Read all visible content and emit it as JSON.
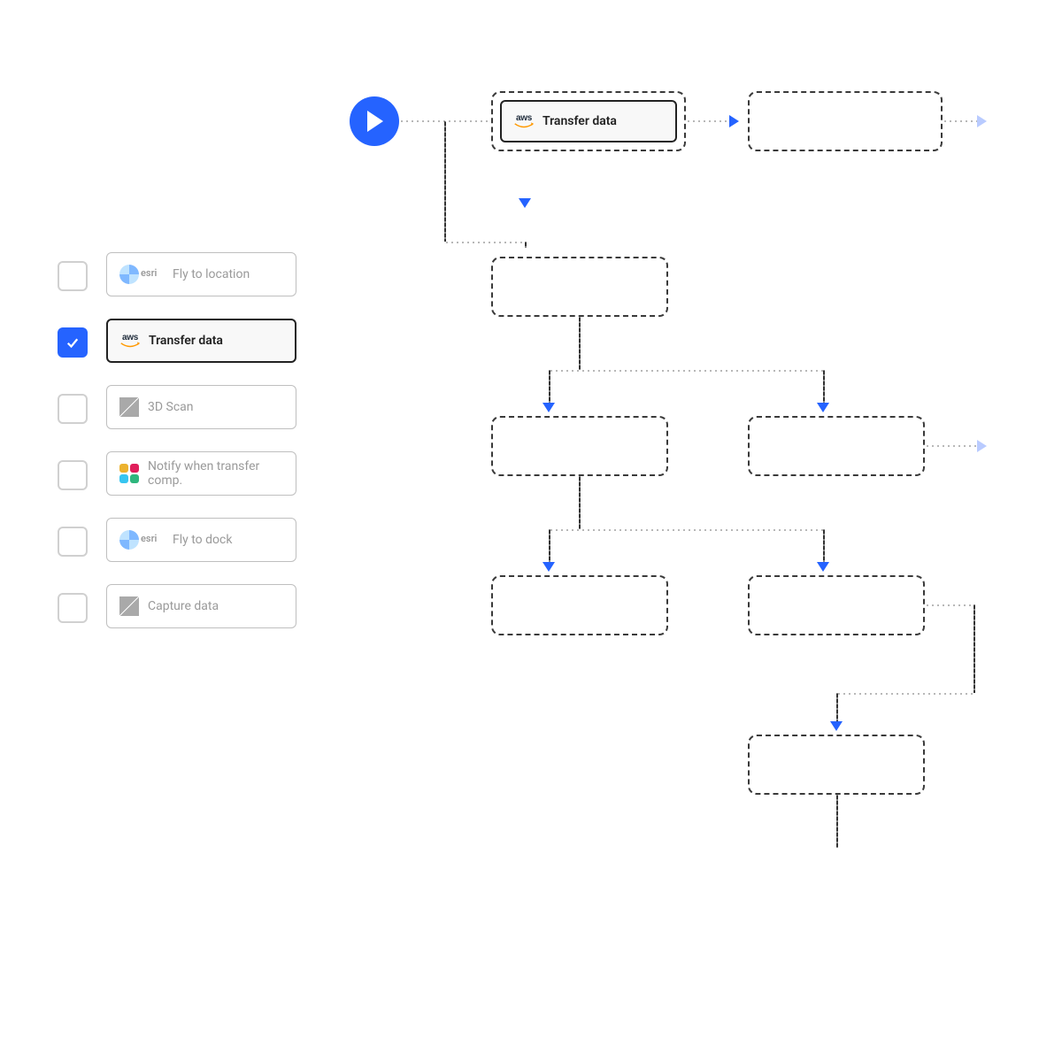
{
  "actions": [
    {
      "label": "Fly to location",
      "icon": "esri",
      "checked": false
    },
    {
      "label": "Transfer data",
      "icon": "aws",
      "checked": true
    },
    {
      "label": "3D Scan",
      "icon": "scan",
      "checked": false
    },
    {
      "label": "Notify when transfer comp.",
      "icon": "slack",
      "checked": false
    },
    {
      "label": "Fly to dock",
      "icon": "esri",
      "checked": false
    },
    {
      "label": "Capture data",
      "icon": "scan",
      "checked": false
    }
  ],
  "flow": {
    "active_node_label": "Transfer data"
  }
}
